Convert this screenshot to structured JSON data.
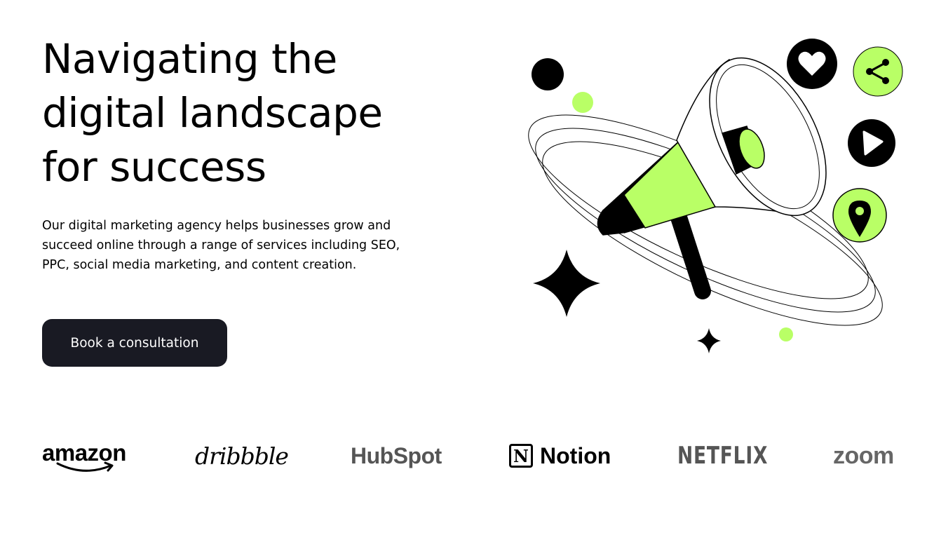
{
  "hero": {
    "title_lines": [
      "Navigating the",
      "digital landscape",
      "for success"
    ],
    "description": "Our digital marketing agency helps businesses grow and succeed online through a range of services including SEO, PPC, social media marketing, and content creation.",
    "cta_label": "Book a consultation"
  },
  "illustration": {
    "subject": "megaphone-with-social-icons",
    "icons": [
      "heart-icon",
      "share-icon",
      "play-icon",
      "location-pin-icon",
      "sparkle-icon"
    ]
  },
  "logos": {
    "items": [
      {
        "name": "amazon",
        "label": "amazon"
      },
      {
        "name": "dribbble",
        "label": "dribbble"
      },
      {
        "name": "hubspot",
        "label": "HubSpot"
      },
      {
        "name": "notion",
        "label": "Notion",
        "mark": "N"
      },
      {
        "name": "netflix",
        "label": "NETFLIX"
      },
      {
        "name": "zoom",
        "label": "zoom"
      }
    ]
  },
  "colors": {
    "accent": "#b9ff66",
    "dark": "#191a23",
    "text": "#000000",
    "background": "#ffffff",
    "logo_gray": "#555555"
  }
}
